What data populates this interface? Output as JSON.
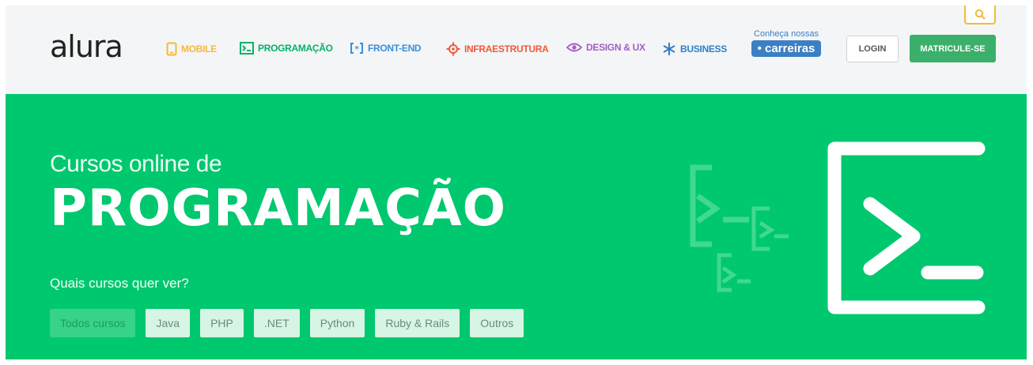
{
  "header": {
    "logo": "alura",
    "nav": [
      {
        "label": "MOBILE",
        "icon": "mobile-icon",
        "color": "#f5b93a"
      },
      {
        "label": "PROGRAMAÇÃO",
        "icon": "terminal-icon",
        "color": "#00b36b"
      },
      {
        "label": "FRONT-END",
        "icon": "frontend-icon",
        "color": "#3b8fd8"
      },
      {
        "label": "INFRAESTRUTURA",
        "icon": "gear-icon",
        "color": "#ef5a3a"
      },
      {
        "label": "DESIGN & UX",
        "icon": "eye-icon",
        "color": "#a35dc4"
      },
      {
        "label": "BUSINESS",
        "icon": "snowflake-icon",
        "color": "#2f7fc9"
      }
    ],
    "carreiras_small": "Conheça nossas",
    "carreiras_label": "carreiras",
    "login_label": "LOGIN",
    "signup_label": "MATRICULE-SE"
  },
  "hero": {
    "subtitle": "Cursos online de",
    "title": "PROGRAMAÇÃO",
    "question": "Quais cursos quer ver?",
    "filters": [
      "Todos cursos",
      "Java",
      "PHP",
      ".NET",
      "Python",
      "Ruby & Rails",
      "Outros"
    ],
    "active_filter": "Todos cursos",
    "background": "#00c86f"
  }
}
